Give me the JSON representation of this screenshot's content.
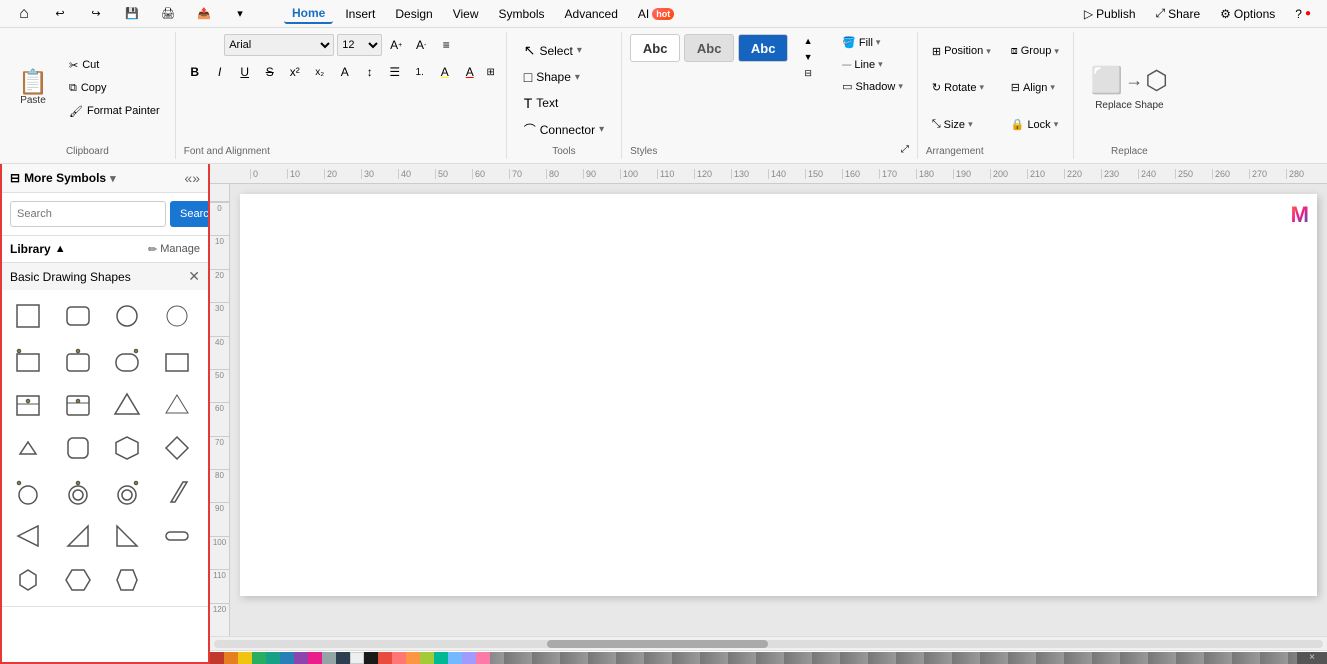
{
  "menubar": {
    "home_icon": "⌂",
    "undo_icon": "↩",
    "redo_icon": "↪",
    "save_icon": "💾",
    "print_icon": "🖨",
    "export_icon": "📤",
    "tabs": [
      "Home",
      "Insert",
      "Design",
      "View",
      "Symbols",
      "Advanced",
      "AI"
    ],
    "active_tab": "Home",
    "ai_hot": true,
    "right_actions": [
      "Publish",
      "Share",
      "Options",
      "?"
    ]
  },
  "ribbon": {
    "clipboard": {
      "label": "Clipboard",
      "paste": "Paste",
      "cut": "Cut",
      "copy": "Copy",
      "format_painter": "Format Painter"
    },
    "font_alignment": {
      "label": "Font and Alignment",
      "font_name": "Arial",
      "font_size": "12",
      "grow_icon": "A↑",
      "shrink_icon": "A↓",
      "align_icon": "≡",
      "bold": "B",
      "italic": "I",
      "underline": "U",
      "strikethrough": "S",
      "superscript": "x²",
      "subscript": "x₂",
      "text_direction": "A",
      "line_spacing": "↕",
      "list": "☰",
      "numbering": "1.",
      "highlight": "A",
      "font_color": "A"
    },
    "tools": {
      "label": "Tools",
      "select": "Select",
      "shape": "Shape",
      "text": "Text",
      "connector": "Connector"
    },
    "styles": {
      "label": "Styles",
      "samples": [
        "Abc",
        "Abc",
        "Abc"
      ],
      "fill": "Fill",
      "line": "Line",
      "shadow": "Shadow"
    },
    "arrangement": {
      "label": "Arrangement",
      "position": "Position",
      "group": "Group",
      "rotate": "Rotate",
      "align": "Align",
      "size": "Size",
      "lock": "Lock"
    },
    "replace": {
      "label": "Replace",
      "replace_shape": "Replace Shape"
    }
  },
  "sidebar": {
    "title": "More Symbols",
    "search_placeholder": "Search",
    "search_btn": "Search",
    "library_label": "Library",
    "manage_btn": "Manage",
    "section_title": "Basic Drawing Shapes",
    "shapes": [
      {
        "name": "square",
        "shape": "rect",
        "rounded": false
      },
      {
        "name": "rounded-rect",
        "shape": "rect",
        "rounded": true
      },
      {
        "name": "circle",
        "shape": "circle"
      },
      {
        "name": "circle-outline",
        "shape": "circle-thin"
      },
      {
        "name": "rect-callout-tl",
        "shape": "rect-dot-tl"
      },
      {
        "name": "rounded-rect-dot",
        "shape": "rounded-dot"
      },
      {
        "name": "rounded-rect2",
        "shape": "rounded2"
      },
      {
        "name": "rect-plain",
        "shape": "rect-plain"
      },
      {
        "name": "container-rect",
        "shape": "container"
      },
      {
        "name": "rect-note",
        "shape": "rect-note"
      },
      {
        "name": "triangle",
        "shape": "triangle"
      },
      {
        "name": "triangle-outline",
        "shape": "triangle-out"
      },
      {
        "name": "triangle-sm",
        "shape": "triangle-sm"
      },
      {
        "name": "rounded-square",
        "shape": "rounded-sq"
      },
      {
        "name": "hexagon",
        "shape": "hexagon"
      },
      {
        "name": "diamond",
        "shape": "diamond"
      },
      {
        "name": "circle-dot-tl",
        "shape": "circle-dot"
      },
      {
        "name": "circle-double",
        "shape": "circle-dbl"
      },
      {
        "name": "circle-double2",
        "shape": "circle-dbl2"
      },
      {
        "name": "parallelogram",
        "shape": "parallelogram"
      },
      {
        "name": "triangle-left",
        "shape": "triangle-left"
      },
      {
        "name": "triangle-right-up",
        "shape": "tri-right-up"
      },
      {
        "name": "triangle-right-small",
        "shape": "tri-right-sm"
      },
      {
        "name": "pill",
        "shape": "pill"
      },
      {
        "name": "hexagon-sm1",
        "shape": "hex-sm1"
      },
      {
        "name": "hexagon-sm2",
        "shape": "hex-sm2"
      },
      {
        "name": "hexagon-sm3",
        "shape": "hex-sm3"
      }
    ]
  },
  "canvas": {
    "ruler_marks_h": [
      "0",
      "10",
      "20",
      "30",
      "40",
      "50",
      "60",
      "70",
      "80",
      "90",
      "100",
      "110",
      "120",
      "130",
      "140",
      "150",
      "160",
      "170",
      "180",
      "190",
      "200",
      "210",
      "220",
      "230",
      "240",
      "250",
      "260",
      "270",
      "280"
    ],
    "ruler_marks_v": [
      "0",
      "10",
      "20",
      "30",
      "40",
      "50",
      "60",
      "70",
      "80",
      "90",
      "100",
      "110",
      "120"
    ]
  },
  "colors": {
    "accent_red": "#e53935",
    "active_tab_blue": "#1a6fc4",
    "search_btn_blue": "#1976d2"
  }
}
